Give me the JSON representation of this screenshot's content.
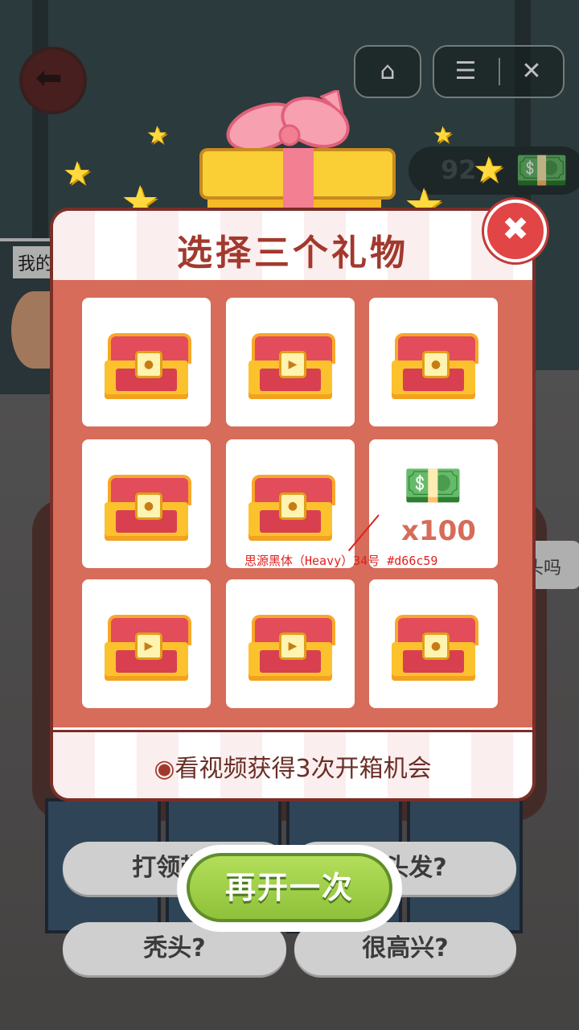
{
  "background": {
    "left_label": "我的",
    "money_value": "92",
    "right_bubble": "头吗",
    "answers": [
      "打领带?",
      "有头发?",
      "秃头?",
      "很高兴?"
    ]
  },
  "icons": {
    "back": "back-arrow-icon",
    "home": "home-icon",
    "menu": "menu-icon",
    "close_app": "close-app-icon",
    "cash": "cash-icon",
    "chest": "chest-icon",
    "video": "video-play-icon"
  },
  "dialog": {
    "title": "选择三个礼物",
    "reward_amount": "x100",
    "annotation": "思源黑体（Heavy）34号 #d66c59",
    "footer": "看视频获得3次开箱机会",
    "close_label": "✖",
    "cells": [
      {
        "type": "chest",
        "lock": "key"
      },
      {
        "type": "chest",
        "lock": "video"
      },
      {
        "type": "chest",
        "lock": "key"
      },
      {
        "type": "chest",
        "lock": "key"
      },
      {
        "type": "chest",
        "lock": "key"
      },
      {
        "type": "reward"
      },
      {
        "type": "chest",
        "lock": "video"
      },
      {
        "type": "chest",
        "lock": "video"
      },
      {
        "type": "chest",
        "lock": "key"
      }
    ]
  },
  "again_button": "再开一次",
  "colors": {
    "accent": "#d66c59",
    "title": "#a2392e",
    "button_green": "#8fc13a"
  }
}
